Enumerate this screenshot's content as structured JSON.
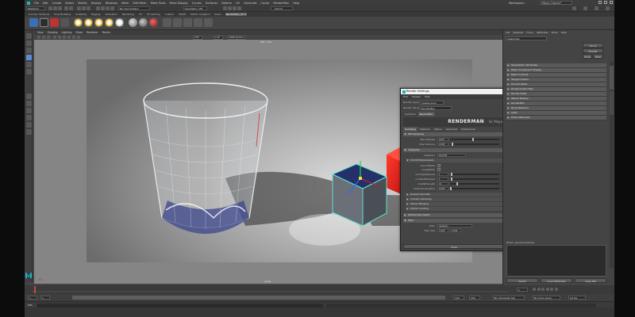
{
  "menubar": {
    "items": [
      "File",
      "Edit",
      "Create",
      "Select",
      "Modify",
      "Display",
      "Windows",
      "Mesh",
      "Edit Mesh",
      "Mesh Tools",
      "Mesh Display",
      "Curves",
      "Surfaces",
      "Deform",
      "UV",
      "Generate",
      "Cache",
      "RenderMan",
      "Help"
    ],
    "workspace": "Workspace :",
    "workspace_value": "Maya Classic*"
  },
  "statusline": {
    "mode": "Modeling",
    "live_surface": "No Live Surface",
    "symmetry": "Symmetry: Off",
    "sign_in": "Sign In"
  },
  "shelf": {
    "tabs": [
      "Curves / Surfaces",
      "Poly Modeling",
      "Sculpting",
      "Rigging",
      "Animation",
      "Rendering",
      "FX",
      "FX Caching",
      "Custom",
      "MASH",
      "Motion Graphics",
      "XGen",
      "RenderMan_22.4"
    ],
    "active_tab": "RenderMan_22.4"
  },
  "viewport": {
    "menu": [
      "View",
      "Shading",
      "Lighting",
      "Show",
      "Renderer",
      "Panels"
    ],
    "camera_label": "persp",
    "resolution_label": "960 x 540",
    "field_value": "0.00",
    "field_value2": "1.00",
    "color_space": "sRGB gamma"
  },
  "dialog": {
    "title": "Render Settings",
    "menu": [
      "Edit",
      "Presets",
      "Help"
    ],
    "render_layer_label": "Render Layer",
    "render_layer_value": "masterLayer",
    "render_using_label": "Render Using",
    "render_using_value": "RenderMan",
    "tabs_top": [
      "Common",
      "RenderMan"
    ],
    "active_top": "RenderMan",
    "brand": "RENDERMAN",
    "brand_suffix": "for Maya",
    "tabs": [
      "Sampling",
      "Features",
      "Optics",
      "Advanced",
      "Preferences"
    ],
    "active_tab": "Sampling",
    "sections": {
      "ipr_sampling": "IPR Sampling",
      "max_samples_label": "Max Samples",
      "max_samples_value": "1024",
      "pixel_variance_label": "Pixel Variance",
      "pixel_variance_value": "0.005",
      "integrator": "Integrator",
      "integrator_label": "Integrator",
      "integrator_value": "PxrVCM",
      "vcm_parameters": "PxrVCM Parameters",
      "connect_paths_label": "connectPaths",
      "merge_paths_label": "mergePaths",
      "num_light_samples_label": "numLightSamples",
      "num_light_samples_value": "1",
      "num_bxdf_samples_label": "numBxdfSamples",
      "num_bxdf_samples_value": "1",
      "max_path_length_label": "maxPathLength",
      "max_path_length_value": "10",
      "radius_label": "photonGuidingProb",
      "radius_value": "0.000",
      "russian_roulette": "Russian Roulette",
      "indirect_clamping": "Indirect Clamping",
      "stereo_merging": "Stereo Merging",
      "photon_guiding": "Photon Guiding",
      "default_ray_depth": "Default Ray Depth",
      "filter": "Filter",
      "filter_label": "Filter",
      "filter_value": "gaussian",
      "filter_size_label": "Filter Size",
      "filter_size_x": "2.000",
      "filter_size_y": "2.000"
    },
    "close_label": "Close"
  },
  "attribute_editor": {
    "tabs": [
      "List",
      "Selected",
      "Focus",
      "Attributes",
      "Show",
      "Help"
    ],
    "node_label": "glassCube",
    "focus_btn": "Focus",
    "presets_btn": "Presets",
    "show_btn": "Show",
    "hide_btn": "Hide",
    "rows": [
      "Tessellation Attributes",
      "Mesh Component Display",
      "Mesh Controls",
      "Tangent Space",
      "Smooth Mesh",
      "Displacement Map",
      "Render Stats",
      "Object Display",
      "RenderMan",
      "Node Behavior",
      "UUID",
      "Extra Attributes"
    ],
    "notes_label": "Notes: glassCubeShape",
    "select_btn": "Select",
    "load_attr_btn": "Load Attributes",
    "copy_tab_btn": "Copy Tab"
  },
  "timeline": {
    "start_values": [
      "1",
      "1"
    ],
    "end_values": [
      "120",
      "200"
    ],
    "right_values": [
      "No Character Set",
      "No Anim Layer",
      "24 fps"
    ],
    "current_frame": "1"
  },
  "cmdline": {
    "mode": "MEL"
  },
  "colors": {
    "window_bg": "#444444",
    "viewport_bg": "#858585",
    "accent_cyan": "#5fe0c8",
    "red_cube": "#e01818",
    "blue_cube_top": "#24306a",
    "maya_logo": "#1fb3c6"
  }
}
